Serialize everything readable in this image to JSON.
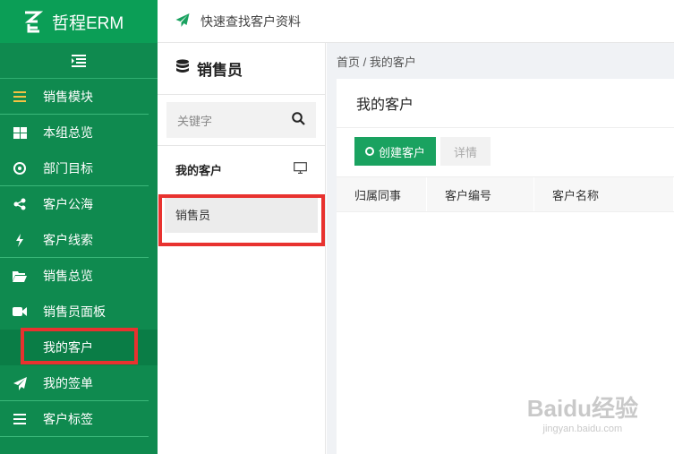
{
  "app": {
    "title": "哲程ERM"
  },
  "topbar": {
    "label": "快速查找客户资料"
  },
  "sidebar": {
    "items": [
      {
        "icon": "menu-lines-icon",
        "label": "销售模块"
      },
      {
        "icon": "grid-icon",
        "label": "本组总览"
      },
      {
        "icon": "target-icon",
        "label": "部门目标"
      },
      {
        "icon": "share-icon",
        "label": "客户公海"
      },
      {
        "icon": "bolt-icon",
        "label": "客户线索"
      },
      {
        "icon": "folder-open-icon",
        "label": "销售总览"
      },
      {
        "icon": "video-camera-icon",
        "label": "销售员面板"
      },
      {
        "icon": "",
        "label": "我的客户"
      },
      {
        "icon": "send-icon",
        "label": "我的签单"
      },
      {
        "icon": "list-icon",
        "label": "客户标签"
      }
    ]
  },
  "mid": {
    "title": "销售员",
    "search_placeholder": "关键字",
    "items": [
      {
        "label": "我的客户"
      },
      {
        "label": "销售员"
      }
    ]
  },
  "main": {
    "breadcrumb": "首页 / 我的客户",
    "title": "我的客户",
    "create_button": "创建客户",
    "detail_button": "详情",
    "columns": [
      "归属同事",
      "客户编号",
      "客户名称"
    ]
  },
  "watermark": {
    "main": "Baidu经验",
    "sub": "jingyan.baidu.com"
  },
  "colors": {
    "sidebar": "#0f8a4f",
    "accent": "#1aa260",
    "highlight": "#e8322f"
  }
}
